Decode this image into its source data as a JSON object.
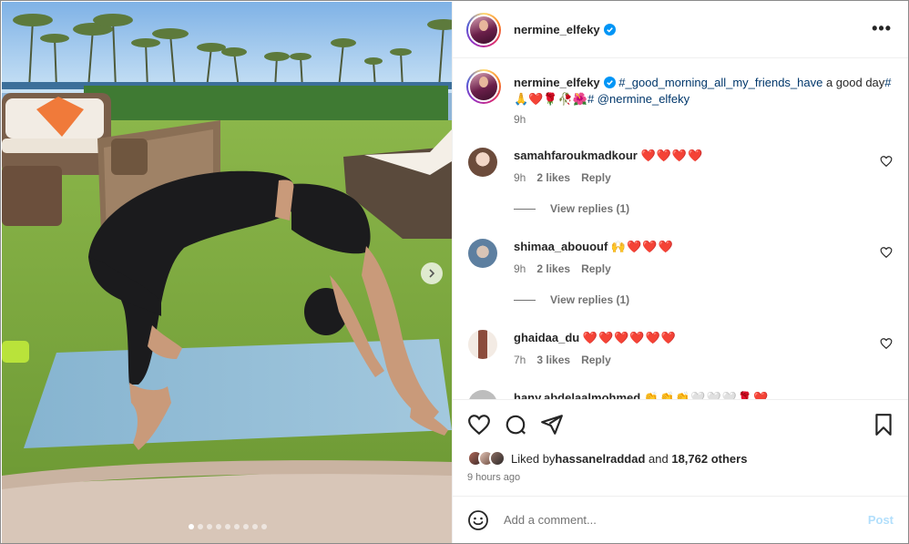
{
  "post": {
    "author": "nermine_elfeky",
    "caption_author": "nermine_elfeky",
    "caption_hashtag": "#_good_morning_all_my_friends_have",
    "caption_text1": " a good day",
    "caption_hashtag2": "#",
    "caption_emojis": "🙏❤️🌹🥀🌺",
    "caption_hashtag3": "#",
    "caption_mention": "@nermine_elfeky",
    "caption_time": "9h",
    "carousel_dots": 9,
    "carousel_active": 0
  },
  "comments": [
    {
      "user": "samahfaroukmadkour",
      "text": "❤️❤️❤️❤️",
      "time": "9h",
      "likes": "2 likes",
      "reply": "Reply",
      "view_replies": "View replies (1)"
    },
    {
      "user": "shimaa_abououf",
      "text": "🙌❤️❤️❤️",
      "time": "9h",
      "likes": "2 likes",
      "reply": "Reply",
      "view_replies": "View replies (1)"
    },
    {
      "user": "ghaidaa_du",
      "text": "❤️❤️❤️❤️❤️❤️",
      "time": "7h",
      "likes": "3 likes",
      "reply": "Reply"
    },
    {
      "user": "hany.abdelaalmohmed",
      "text": "👏👏👏🤍🤍🤍🌹❤️"
    }
  ],
  "actions": {
    "liked_by_prefix": "Liked by ",
    "liked_by_user": "hassanelraddad",
    "liked_by_and": " and ",
    "liked_by_others": "18,762 others",
    "time_ago": "9 hours ago"
  },
  "add_comment": {
    "placeholder": "Add a comment...",
    "post_label": "Post"
  },
  "colors": {
    "link": "#00376b",
    "verified": "#0095f6",
    "post_disabled": "#b2dffc"
  }
}
